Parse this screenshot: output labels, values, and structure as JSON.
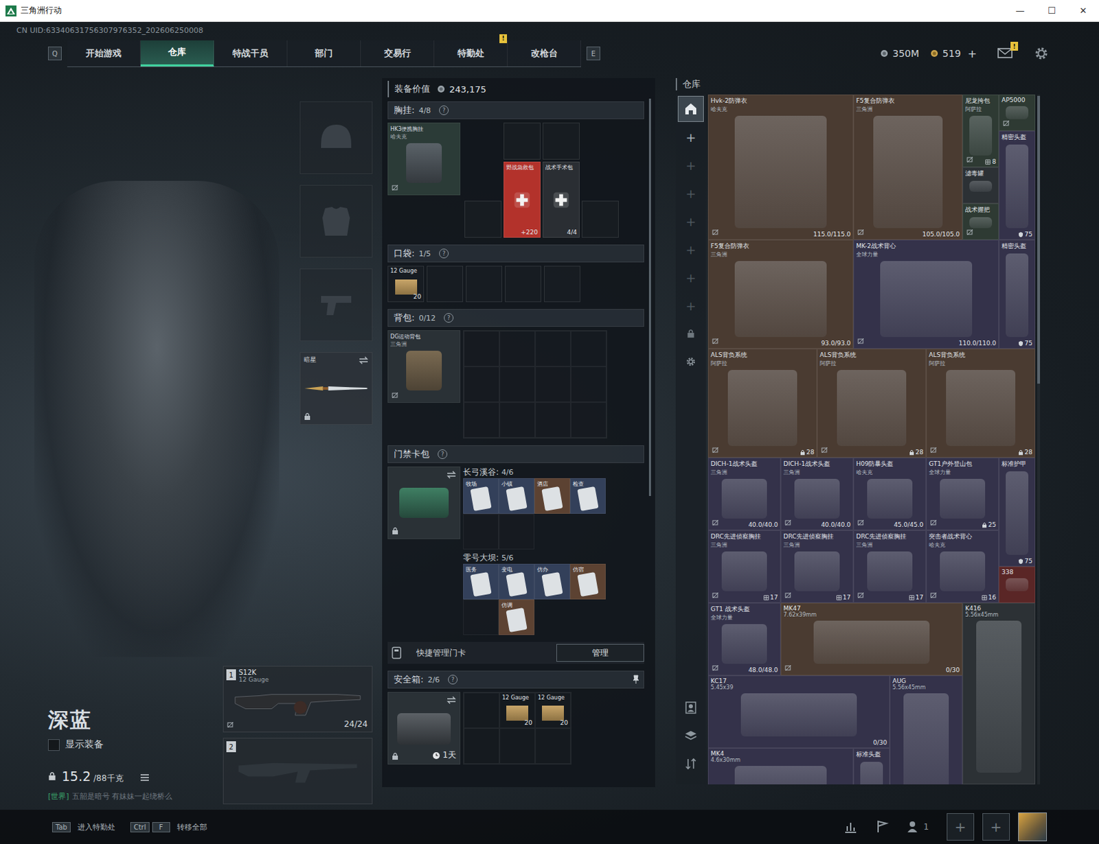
{
  "window": {
    "title": "三角洲行动",
    "controls": [
      "—",
      "☐",
      "✕"
    ]
  },
  "uid": "CN UID:63340631756307976352_202606250008",
  "nav": {
    "keys": [
      "Q",
      "E"
    ],
    "tabs": [
      {
        "label": "开始游戏",
        "selected": false,
        "badge": ""
      },
      {
        "label": "仓库",
        "selected": true,
        "badge": ""
      },
      {
        "label": "特战干员",
        "selected": false,
        "badge": ""
      },
      {
        "label": "部门",
        "selected": false,
        "badge": ""
      },
      {
        "label": "交易行",
        "selected": false,
        "badge": ""
      },
      {
        "label": "特勤处",
        "selected": false,
        "badge": "!"
      },
      {
        "label": "改枪台",
        "selected": false,
        "badge": ""
      }
    ]
  },
  "currency": {
    "cash": "350M",
    "coins": "519",
    "add": "+",
    "mail_badge": "!"
  },
  "operator": {
    "name": "深蓝",
    "show_gear": {
      "label": "显示装备",
      "checked": false
    },
    "weight": "15.2",
    "weight_max": "/88千克",
    "chat_channel": "[世界]",
    "chat_text": "五韶是暗号 有妹妹一起绕桥么"
  },
  "gear_slots": [
    {
      "kind": "helmet",
      "filled": false
    },
    {
      "kind": "armor",
      "filled": false
    },
    {
      "kind": "pistol",
      "filled": false
    },
    {
      "kind": "melee",
      "filled": true,
      "label": "暗星",
      "locked": true
    }
  ],
  "weapons": [
    {
      "slot": "1",
      "filled": true,
      "name": "S12K",
      "caliber": "12 Gauge",
      "ammo": "24/24"
    },
    {
      "slot": "2",
      "filled": false
    }
  ],
  "loadout": {
    "value_label": "装备价值",
    "value": "243,175",
    "chest": {
      "label": "胸挂:",
      "count": "4/8",
      "help": "?",
      "item": {
        "name": "HK3便携胸挂",
        "faction": "哈夫克"
      },
      "slots": [
        {
          "kind": "empty"
        },
        {
          "kind": "empty"
        },
        {
          "kind": "empty"
        },
        {
          "kind": "item",
          "name": "野战急救包",
          "value": "+220",
          "color": "#b3322b"
        },
        {
          "kind": "item",
          "name": "战术手术包",
          "value": "4/4",
          "color": "#2a2e33"
        },
        {
          "kind": "empty"
        }
      ]
    },
    "pocket": {
      "label": "口袋:",
      "count": "1/5",
      "help": "?",
      "slots": [
        {
          "kind": "item",
          "name": "12 Gauge",
          "value": "20"
        },
        {
          "kind": "empty"
        },
        {
          "kind": "empty"
        },
        {
          "kind": "empty"
        },
        {
          "kind": "empty"
        }
      ]
    },
    "backpack": {
      "label": "背包:",
      "count": "0/12",
      "help": "?",
      "item": {
        "name": "DG运动背包",
        "faction": "三角洲"
      },
      "empty_cells": 12
    },
    "keycards": {
      "label": "门禁卡包",
      "help": "?",
      "maps": [
        {
          "label": "长弓溪谷:",
          "count": "4/6",
          "slots": [
            {
              "kind": "card",
              "name": "牧场",
              "color": "#33405a"
            },
            {
              "kind": "card",
              "name": "小镇",
              "color": "#33405a"
            },
            {
              "kind": "card",
              "name": "酒店",
              "color": "#5c4232"
            },
            {
              "kind": "card",
              "name": "检查",
              "color": "#33405a"
            },
            {
              "kind": "empty"
            },
            {
              "kind": "empty"
            }
          ]
        },
        {
          "label": "零号大坝:",
          "count": "5/6",
          "slots": [
            {
              "kind": "card",
              "name": "医务",
              "color": "#33405a"
            },
            {
              "kind": "card",
              "name": "变电",
              "color": "#33405a"
            },
            {
              "kind": "card",
              "name": "仿办",
              "color": "#33405a"
            },
            {
              "kind": "card",
              "name": "仿宿",
              "color": "#5c4232"
            },
            {
              "kind": "empty"
            },
            {
              "kind": "card",
              "name": "仿调",
              "color": "#5c4232"
            }
          ]
        }
      ],
      "manage_label": "快捷管理门卡",
      "manage_button": "管理"
    },
    "safe": {
      "label": "安全箱:",
      "count": "2/6",
      "help": "?",
      "timer": "1天",
      "slots": [
        {
          "kind": "empty"
        },
        {
          "kind": "item",
          "name": "12 Gauge",
          "value": "20"
        },
        {
          "kind": "item",
          "name": "12 Gauge",
          "value": "20"
        },
        {
          "kind": "empty"
        },
        {
          "kind": "empty"
        },
        {
          "kind": "empty"
        }
      ]
    }
  },
  "warehouse": {
    "title": "仓库",
    "sidebar": [
      {
        "kind": "home",
        "selected": true,
        "disabled": false
      },
      {
        "kind": "add",
        "text": "+",
        "selected": false,
        "disabled": false
      },
      {
        "kind": "add",
        "text": "+",
        "selected": false,
        "disabled": true
      },
      {
        "kind": "add",
        "text": "+",
        "selected": false,
        "disabled": true
      },
      {
        "kind": "add",
        "text": "+",
        "selected": false,
        "disabled": true
      },
      {
        "kind": "add",
        "text": "+",
        "selected": false,
        "disabled": true
      },
      {
        "kind": "add",
        "text": "+",
        "selected": false,
        "disabled": true
      },
      {
        "kind": "add",
        "text": "+",
        "selected": false,
        "disabled": true
      },
      {
        "kind": "lock",
        "selected": false,
        "disabled": true
      },
      {
        "kind": "gear",
        "selected": false,
        "disabled": false
      }
    ],
    "tools": [
      {
        "kind": "person"
      },
      {
        "kind": "layers"
      },
      {
        "kind": "sort"
      }
    ],
    "items": [
      {
        "name": "Hvk-2防弹衣",
        "sub": "哈夫克",
        "value": "115.0/115.0",
        "valueKind": "durability",
        "color": "#4a3b31",
        "bound": true
      },
      {
        "name": "F5复合防弹衣",
        "sub": "三角洲",
        "value": "105.0/105.0",
        "valueKind": "durability",
        "color": "#4a3b31",
        "bound": true
      },
      {
        "name": "尼龙挎包",
        "sub": "阿萨拉",
        "value": "8",
        "valueKind": "capacity",
        "color": "#2e3a33",
        "bound": true
      },
      {
        "name": "AP5000",
        "sub": "",
        "value": "",
        "valueKind": "none",
        "color": "#2e3a33",
        "bound": true
      },
      {
        "name": "精密头盔",
        "sub": "",
        "value": "75",
        "valueKind": "level",
        "color": "#34324a",
        "bound": false
      },
      {
        "name": "滤毒罐",
        "sub": "",
        "value": "",
        "valueKind": "none",
        "color": "#2c3135",
        "bound": false
      },
      {
        "name": "战术握把",
        "sub": "",
        "value": "",
        "valueKind": "none",
        "color": "#2e3a33",
        "bound": true
      },
      {
        "name": "F5复合防弹衣",
        "sub": "三角洲",
        "value": "93.0/93.0",
        "valueKind": "durability",
        "color": "#4a3b31",
        "bound": true
      },
      {
        "name": "MK-2战术背心",
        "sub": "全球力量",
        "value": "110.0/110.0",
        "valueKind": "durability",
        "color": "#34324a",
        "bound": true
      },
      {
        "name": "精密头盔",
        "sub": "",
        "value": "75",
        "valueKind": "level",
        "color": "#34324a",
        "bound": false
      },
      {
        "name": "ALS背负系统",
        "sub": "阿萨拉",
        "value": "28",
        "valueKind": "lock",
        "color": "#4a3b31",
        "bound": true
      },
      {
        "name": "ALS背负系统",
        "sub": "阿萨拉",
        "value": "28",
        "valueKind": "lock",
        "color": "#4a3b31",
        "bound": true
      },
      {
        "name": "ALS背负系统",
        "sub": "阿萨拉",
        "value": "28",
        "valueKind": "lock",
        "color": "#4a3b31",
        "bound": true
      },
      {
        "name": "DICH-1战术头盔",
        "sub": "三角洲",
        "value": "40.0/40.0",
        "valueKind": "durability",
        "color": "#34324a",
        "bound": true
      },
      {
        "name": "DICH-1战术头盔",
        "sub": "三角洲",
        "value": "40.0/40.0",
        "valueKind": "durability",
        "color": "#34324a",
        "bound": true
      },
      {
        "name": "H09防暴头盔",
        "sub": "哈夫克",
        "value": "45.0/45.0",
        "valueKind": "durability",
        "color": "#34324a",
        "bound": true
      },
      {
        "name": "GT1户外登山包",
        "sub": "全球力量",
        "value": "25",
        "valueKind": "lock",
        "color": "#34324a",
        "bound": true
      },
      {
        "name": "标准护甲",
        "sub": "",
        "value": "75",
        "valueKind": "level",
        "color": "#34324a",
        "bound": false
      },
      {
        "name": "DRC先进侦察胸挂",
        "sub": "三角洲",
        "value": "17",
        "valueKind": "capacity",
        "color": "#34324a",
        "bound": true
      },
      {
        "name": "DRC先进侦察胸挂",
        "sub": "三角洲",
        "value": "17",
        "valueKind": "capacity",
        "color": "#34324a",
        "bound": true
      },
      {
        "name": "DRC先进侦察胸挂",
        "sub": "三角洲",
        "value": "17",
        "valueKind": "capacity",
        "color": "#34324a",
        "bound": true
      },
      {
        "name": "突击者战术背心",
        "sub": "哈夫克",
        "value": "16",
        "valueKind": "capacity",
        "color": "#34324a",
        "bound": true
      },
      {
        "name": "338",
        "sub": "",
        "value": "",
        "valueKind": "none",
        "color": "#5a2626",
        "bound": false
      },
      {
        "name": "GT1 战术头盔",
        "sub": "全球力量",
        "value": "48.0/48.0",
        "valueKind": "durability",
        "color": "#34324a",
        "bound": true
      },
      {
        "name": "MK47",
        "sub": "7.62x39mm",
        "value": "0/30",
        "valueKind": "ammo",
        "color": "#4a3b31",
        "bound": true
      },
      {
        "name": "K416",
        "sub": "5.56x45mm",
        "value": "",
        "valueKind": "none",
        "color": "#2c3135",
        "bound": false
      },
      {
        "name": "KC17",
        "sub": "5.45x39",
        "value": "0/30",
        "valueKind": "ammo",
        "color": "#34324a",
        "bound": false
      },
      {
        "name": "AUG",
        "sub": "5.56x45mm",
        "value": "",
        "valueKind": "none",
        "color": "#34324a",
        "bound": false
      },
      {
        "name": "MK4",
        "sub": "4.6x30mm",
        "value": "",
        "valueKind": "none",
        "color": "#34324a",
        "bound": false
      },
      {
        "name": "标准头盔",
        "sub": "",
        "value": "",
        "valueKind": "none",
        "color": "#34324a",
        "bound": false
      }
    ]
  },
  "bottom": {
    "hints": [
      {
        "keys": [
          "Tab"
        ],
        "label": "进入特勤处"
      },
      {
        "keys": [
          "Ctrl",
          "F"
        ],
        "label": "转移全部"
      }
    ],
    "friends": "1",
    "slots": [
      "+",
      "+"
    ]
  }
}
